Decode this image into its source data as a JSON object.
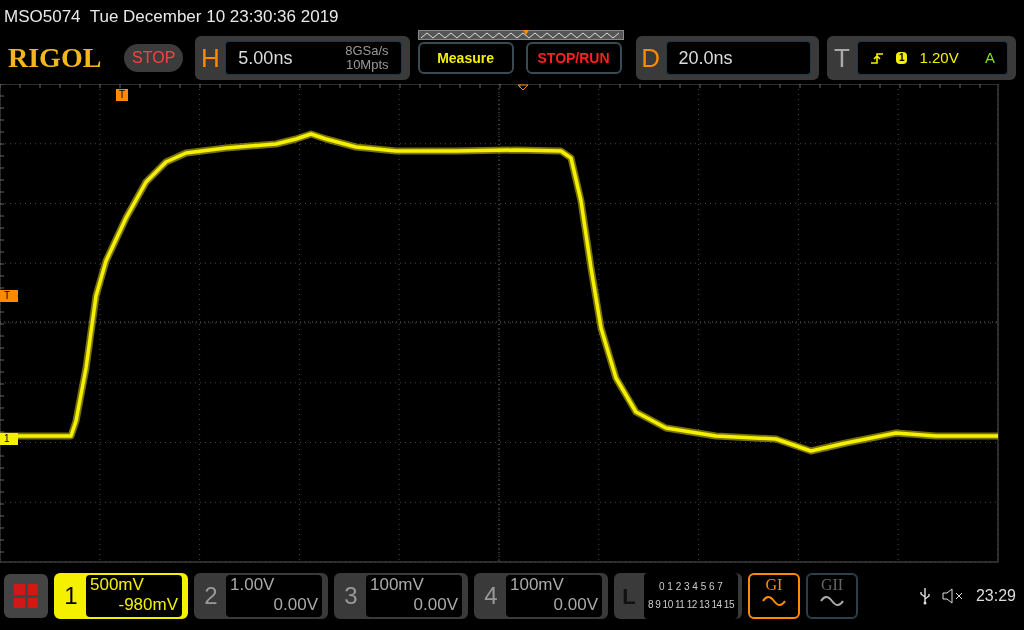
{
  "status_line": "MSO5074  Tue December 10 23:30:36 2019",
  "logo": "RIGOL",
  "run_state": "STOP",
  "horizontal": {
    "label": "H",
    "scale": "5.00ns",
    "sample_rate": "8GSa/s",
    "memory_depth": "10Mpts"
  },
  "buttons": [
    {
      "label": "Measure",
      "kind": "measure"
    },
    {
      "label": "STOP/RUN",
      "kind": "stoprun"
    }
  ],
  "delay": {
    "label": "D",
    "value": "20.0ns"
  },
  "trigger": {
    "label": "T",
    "source": "1",
    "trigger_level": "1.20V",
    "mode": "A"
  },
  "screen_markers": {
    "trigger_position": "T",
    "trigger_level": "T",
    "channel": "1"
  },
  "channels": [
    {
      "number": "1",
      "scale": "500mV",
      "offset": "-980mV",
      "selected": true
    },
    {
      "number": "2",
      "scale": "1.00V",
      "offset": "0.00V",
      "selected": false
    },
    {
      "number": "3",
      "scale": "100mV",
      "offset": "0.00V",
      "selected": false
    },
    {
      "number": "4",
      "scale": "100mV",
      "offset": "0.00V",
      "selected": false
    }
  ],
  "logic": {
    "label": "L",
    "row_1": [
      "0",
      "1",
      "2",
      "3",
      "4",
      "5",
      "6",
      "7"
    ],
    "row_2": [
      "8",
      "9",
      "10",
      "11",
      "12",
      "13",
      "14",
      "15"
    ]
  },
  "generators": [
    {
      "label": "GI",
      "selected": true
    },
    {
      "label": "GII",
      "selected": false
    }
  ],
  "clock": "23:29"
}
